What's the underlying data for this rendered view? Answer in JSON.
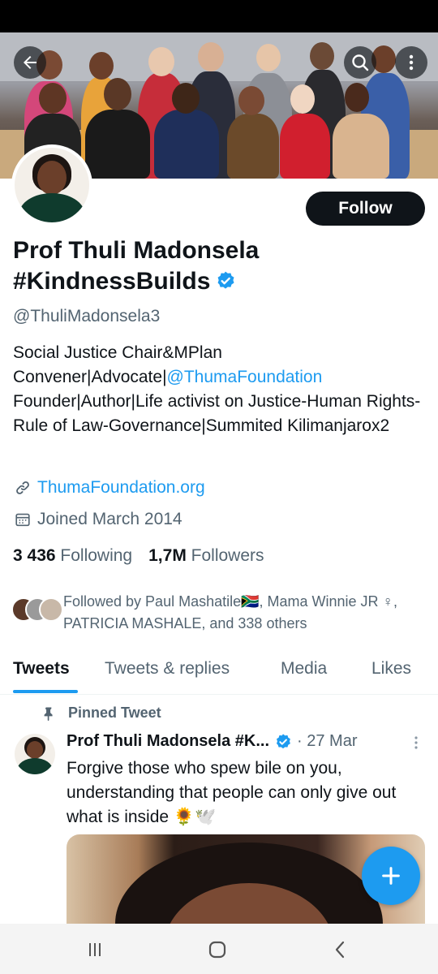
{
  "profile": {
    "name_line1": "Prof Thuli Madonsela",
    "name_line2": "#KindnessBuilds",
    "handle": "@ThuliMadonsela3",
    "follow_label": "Follow",
    "bio_part1": "Social Justice Chair&MPlan Convener|Advocate|",
    "bio_mention": "@ThumaFoundation",
    "bio_part2": " Founder|Author|Life activist on Justice-Human Rights-Rule of Law-Governance|Summited Kilimanjarox2",
    "website": "ThumaFoundation.org",
    "joined": "Joined March 2014",
    "following_count": "3 436",
    "following_label": "Following",
    "followers_count": "1,7M",
    "followers_label": "Followers",
    "followed_by": "Followed by Paul Mashatile🇿🇦, Mama Winnie JR ♀, PATRICIA MASHALE, and 338 others"
  },
  "header_icons": {
    "back": "back-arrow-icon",
    "search": "search-icon",
    "more": "more-vertical-icon"
  },
  "tabs": [
    {
      "label": "Tweets",
      "active": true
    },
    {
      "label": "Tweets & replies",
      "active": false
    },
    {
      "label": "Media",
      "active": false
    },
    {
      "label": "Likes",
      "active": false
    }
  ],
  "pinned_tweet": {
    "pinned_label": "Pinned Tweet",
    "author": "Prof Thuli Madonsela #K...",
    "date": "· 27 Mar",
    "text": "Forgive those who spew bile on you, understanding that people can only give out what is inside 🌻🕊️"
  },
  "colors": {
    "accent": "#1d9bf0",
    "text_primary": "#0f1419",
    "text_secondary": "#536471"
  }
}
